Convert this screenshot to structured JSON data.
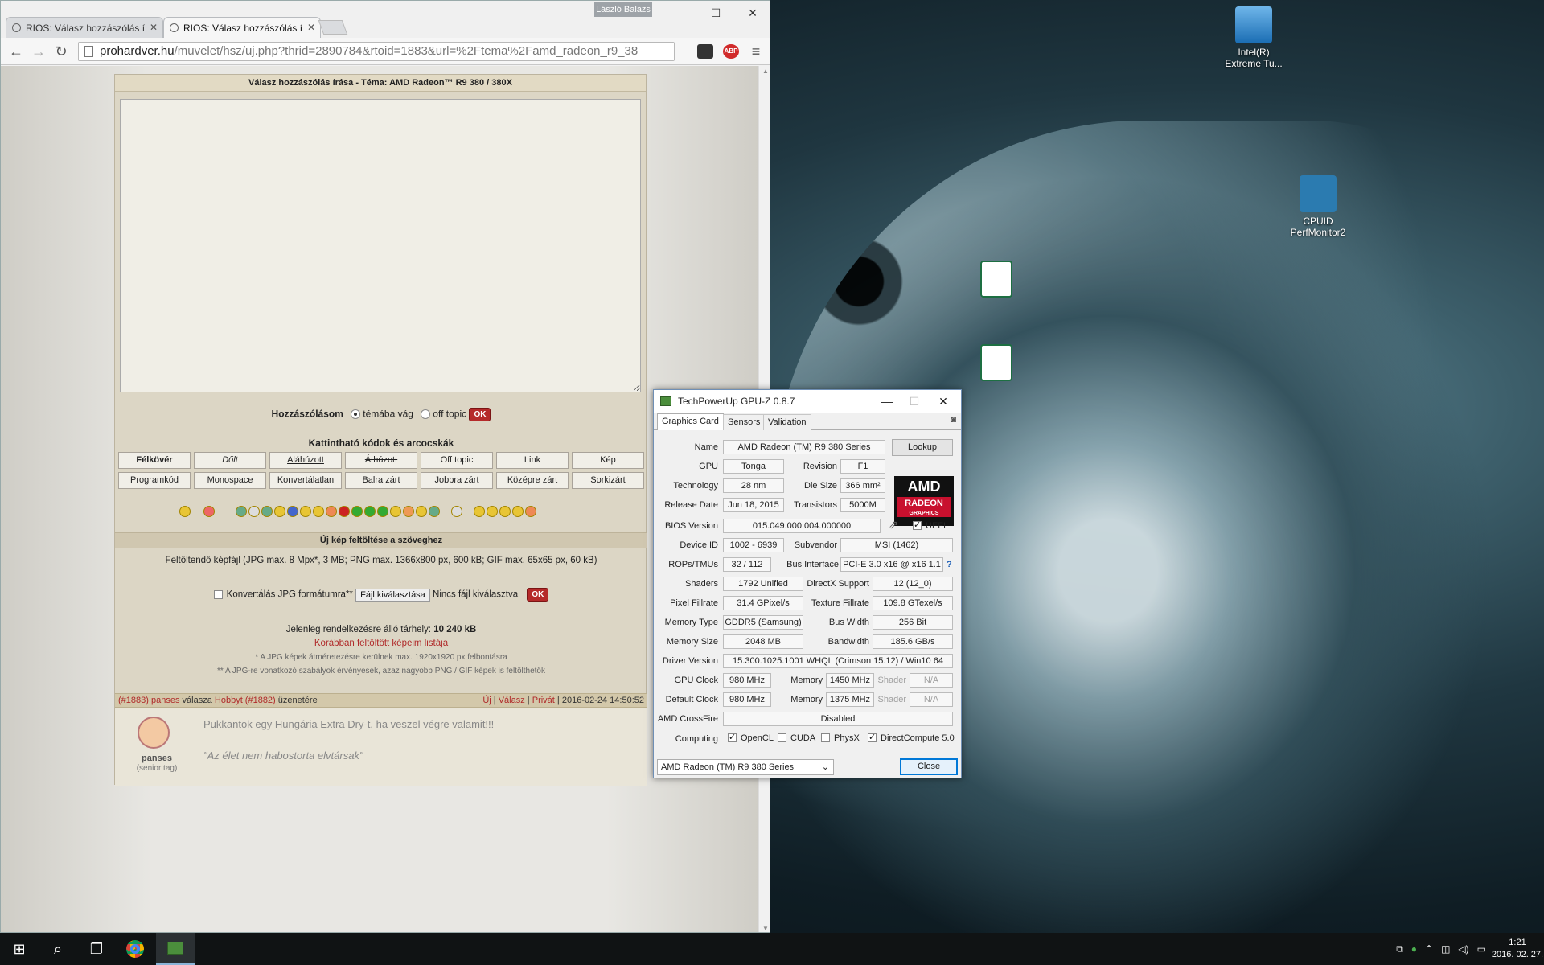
{
  "desktop": {
    "icons": [
      {
        "label": "Intel(R) Extreme Tu..."
      },
      {
        "label": "CPUID PerfMonitor2"
      }
    ]
  },
  "taskbar": {
    "time": "1:21",
    "date": "2016. 02. 27."
  },
  "browser": {
    "user": "László Balázs",
    "tabs": [
      {
        "label": "RIOS: Válasz hozzászólás í"
      },
      {
        "label": "RIOS: Válasz hozzászólás í"
      }
    ],
    "url_host": "prohardver.hu",
    "url_path": "/muvelet/hsz/uj.php?thrid=2890784&rtoid=1883&url=%2Ftema%2Famd_radeon_r9_38",
    "ext_abp": "ABP"
  },
  "forum": {
    "title": "Válasz hozzászólás írása - Téma: AMD Radeon™ R9 380 / 380X",
    "post_label": "Hozzászólásom",
    "opt_topic": "témába vág",
    "opt_offtopic": "off topic",
    "ok": "OK",
    "codes_title": "Kattintható kódok és arcocskák",
    "codes": [
      "Félkövér",
      "Dőlt",
      "Aláhúzott",
      "Áthúzott",
      "Off topic",
      "Link",
      "Kép",
      "Programkód",
      "Monospace",
      "Konvertálatlan",
      "Balra zárt",
      "Jobbra zárt",
      "Középre zárt",
      "Sorkizárt"
    ],
    "upload_title": "Új kép feltöltése a szöveghez",
    "upload_hint": "Feltöltendő képfájl (JPG max. 8 Mpx*, 3 MB; PNG max. 1366x800 px, 600 kB; GIF max. 65x65 px, 60 kB)",
    "convert_label": "Konvertálás JPG formátumra**",
    "choose_file": "Fájl kiválasztása",
    "no_file": "Nincs fájl kiválasztva",
    "storage_label": "Jelenleg rendelkezésre álló tárhely:",
    "storage_value": "10 240 kB",
    "prev_uploads": "Korábban feltöltött képeim listája",
    "note1": "* A JPG képek átméretezésre kerülnek max. 1920x1920 px felbontásra",
    "note2": "** A JPG-re vonatkozó szabályok érvényesek, azaz nagyobb PNG / GIF képek is feltölthetők",
    "post_id": "(#1883)",
    "post_author": "panses",
    "post_reply_word": "válasza",
    "post_target": "Hobbyt (#1882)",
    "post_target_word": "üzenetére",
    "post_actions": [
      "Új",
      "Válasz",
      "Privát"
    ],
    "post_date": "2016-02-24 14:50:52",
    "post_text": "Pukkantok egy Hungária Extra Dry-t, ha veszel végre valamit!!!",
    "post_sig": "\"Az élet nem habostorta elvtársak\"",
    "post_rank": "(senior tag)"
  },
  "gpuz": {
    "title": "TechPowerUp GPU-Z 0.8.7",
    "tabs": [
      "Graphics Card",
      "Sensors",
      "Validation"
    ],
    "name_l": "Name",
    "name": "AMD Radeon (TM) R9 380 Series",
    "lookup": "Lookup",
    "gpu_l": "GPU",
    "gpu": "Tonga",
    "rev_l": "Revision",
    "rev": "F1",
    "tech_l": "Technology",
    "tech": "28 nm",
    "die_l": "Die Size",
    "die": "366 mm²",
    "rel_l": "Release Date",
    "rel": "Jun 18, 2015",
    "trans_l": "Transistors",
    "trans": "5000M",
    "bios_l": "BIOS Version",
    "bios": "015.049.000.004.000000",
    "uefi": "UEFI",
    "dev_l": "Device ID",
    "dev": "1002 - 6939",
    "sub_l": "Subvendor",
    "sub": "MSI (1462)",
    "rops_l": "ROPs/TMUs",
    "rops": "32 / 112",
    "bus_l": "Bus Interface",
    "bus": "PCI-E 3.0 x16 @ x16 1.1",
    "q": "?",
    "shad_l": "Shaders",
    "shad": "1792 Unified",
    "dx_l": "DirectX Support",
    "dx": "12 (12_0)",
    "pix_l": "Pixel Fillrate",
    "pix": "31.4 GPixel/s",
    "tex_l": "Texture Fillrate",
    "tex": "109.8 GTexel/s",
    "mtype_l": "Memory Type",
    "mtype": "GDDR5 (Samsung)",
    "bw_l": "Bus Width",
    "bw": "256 Bit",
    "msize_l": "Memory Size",
    "msize": "2048 MB",
    "band_l": "Bandwidth",
    "band": "185.6 GB/s",
    "drv_l": "Driver Version",
    "drv": "15.300.1025.1001 WHQL (Crimson 15.12) / Win10 64",
    "gclk_l": "GPU Clock",
    "gclk": "980 MHz",
    "mem_l": "Memory",
    "gmem": "1450 MHz",
    "shader_l": "Shader",
    "na": "N/A",
    "dclk_l": "Default Clock",
    "dclk": "980 MHz",
    "dmem": "1375 MHz",
    "cf_l": "AMD CrossFire",
    "cf": "Disabled",
    "comp_l": "Computing",
    "opencl": "OpenCL",
    "cuda": "CUDA",
    "physx": "PhysX",
    "dc": "DirectCompute 5.0",
    "select": "AMD Radeon (TM) R9 380 Series",
    "close": "Close",
    "logo_amd": "AMD",
    "logo_radeon": "RADEON",
    "logo_graphics": "GRAPHICS"
  }
}
